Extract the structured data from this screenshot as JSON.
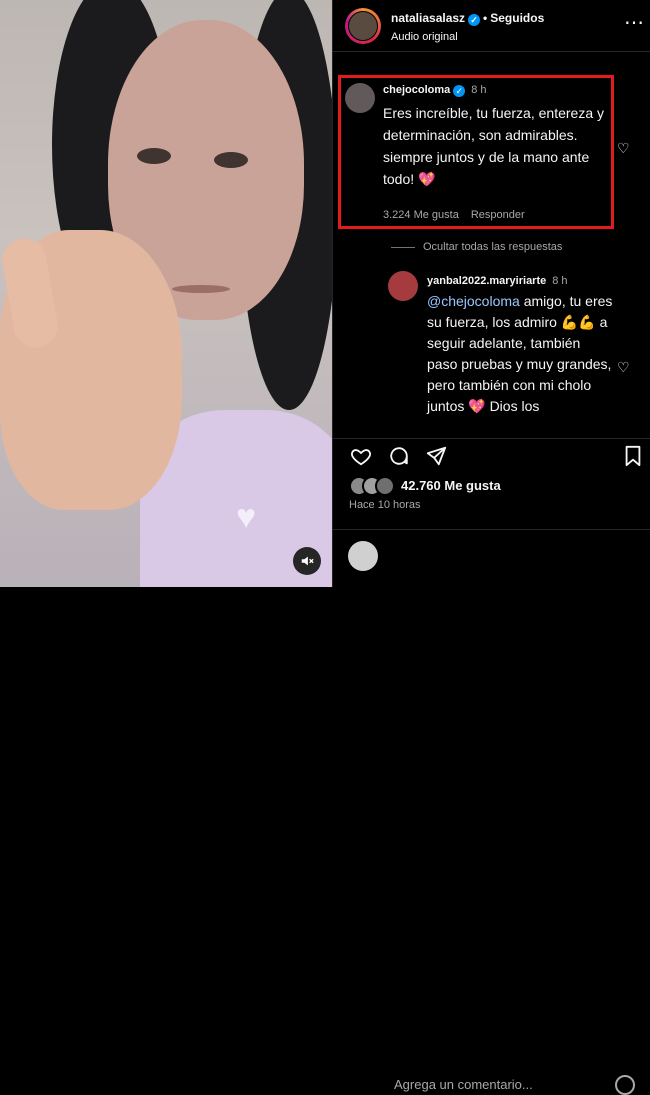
{
  "post": {
    "username": "nataliasalasz",
    "verified": true,
    "separator": "•",
    "follow_status": "Seguidos",
    "audio": "Audio original",
    "more_icon": "more-icon"
  },
  "comment": {
    "username": "chejocoloma",
    "verified": true,
    "time": "8 h",
    "text": "Eres increíble, tu fuerza, entereza y determinación, son admirables. siempre juntos y de la mano ante todo! 💖",
    "likes": "3.224 Me gusta",
    "reply": "Responder",
    "hide_replies": "Ocultar todas las respuestas"
  },
  "reply": {
    "username": "yanbal2022.maryiriarte",
    "time": "8 h",
    "mention": "@chejocoloma",
    "text": " amigo, tu eres su fuerza, los admiro 💪💪 a seguir adelante, también paso pruebas y muy grandes, pero también con mi cholo juntos 💖 Dios los"
  },
  "actions": {
    "like_icon": "heart-outline-icon",
    "comment_icon": "comment-icon",
    "share_icon": "share-icon",
    "save_icon": "bookmark-icon"
  },
  "footer": {
    "likes": "42.760 Me gusta",
    "time_ago": "Hace 10 horas",
    "comment_placeholder": "Agrega un comentario...",
    "emoji_icon": "emoji-icon"
  },
  "colors": {
    "highlight": "#e31b1b",
    "verified": "#0095f6",
    "like_heart": "#ff5a8a"
  }
}
